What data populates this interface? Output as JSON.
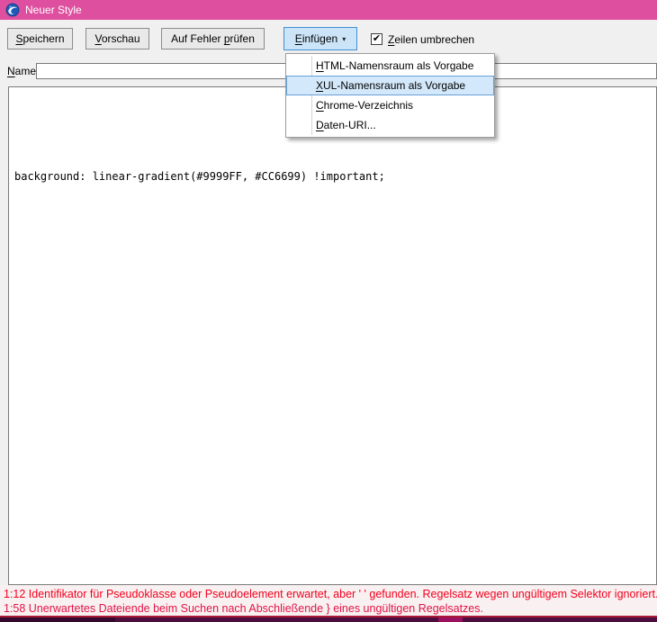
{
  "window": {
    "title": "Neuer Style",
    "app_icon": "thunderbird-globe-icon"
  },
  "colors": {
    "titlebar": "#de4f9f",
    "button_face": "#e9e9e9",
    "active_button_face": "#cce4f7",
    "active_button_border": "#3f8fd4",
    "menu_selection_fill": "#d3e8fa",
    "menu_selection_border": "#66a1d8",
    "error_line_1": "#f2001e",
    "error_line_2": "#e11346",
    "bottom_edge": "#4c0e3c"
  },
  "toolbar": {
    "buttons": [
      {
        "pre": "",
        "key": "S",
        "post": "peichern"
      },
      {
        "pre": "",
        "key": "V",
        "post": "orschau"
      },
      {
        "pre": "Auf Fehler ",
        "key": "p",
        "post": "rüfen"
      }
    ],
    "insert_button": {
      "pre": "",
      "key": "E",
      "post": "infügen",
      "arrow": "▾"
    },
    "wrap_checkbox": {
      "checked": true,
      "glyph": "✔",
      "label": {
        "pre": "",
        "key": "Z",
        "post": "eilen umbrechen"
      }
    }
  },
  "name_field": {
    "label": {
      "pre": "",
      "key": "N",
      "post": "ame"
    },
    "value": "",
    "placeholder": ""
  },
  "editor": {
    "code": "background: linear-gradient(#9999FF, #CC6699) !important;"
  },
  "menu": {
    "items": [
      {
        "pre": "",
        "key": "H",
        "post": "TML-Namensraum als Vorgabe",
        "selected": false
      },
      {
        "pre": "",
        "key": "X",
        "post": "UL-Namensraum als Vorgabe",
        "selected": true
      },
      {
        "pre": "",
        "key": "C",
        "post": "hrome-Verzeichnis",
        "selected": false
      },
      {
        "pre": "",
        "key": "D",
        "post": "aten-URI...",
        "selected": false
      }
    ]
  },
  "errors": [
    "1:12 Identifikator für Pseudoklasse oder Pseudoelement erwartet, aber ' ' gefunden. Regelsatz wegen ungültigem Selektor ignoriert.",
    "1:58 Unerwartetes Dateiende beim Suchen nach Abschließende } eines ungültigen Regelsatzes."
  ]
}
